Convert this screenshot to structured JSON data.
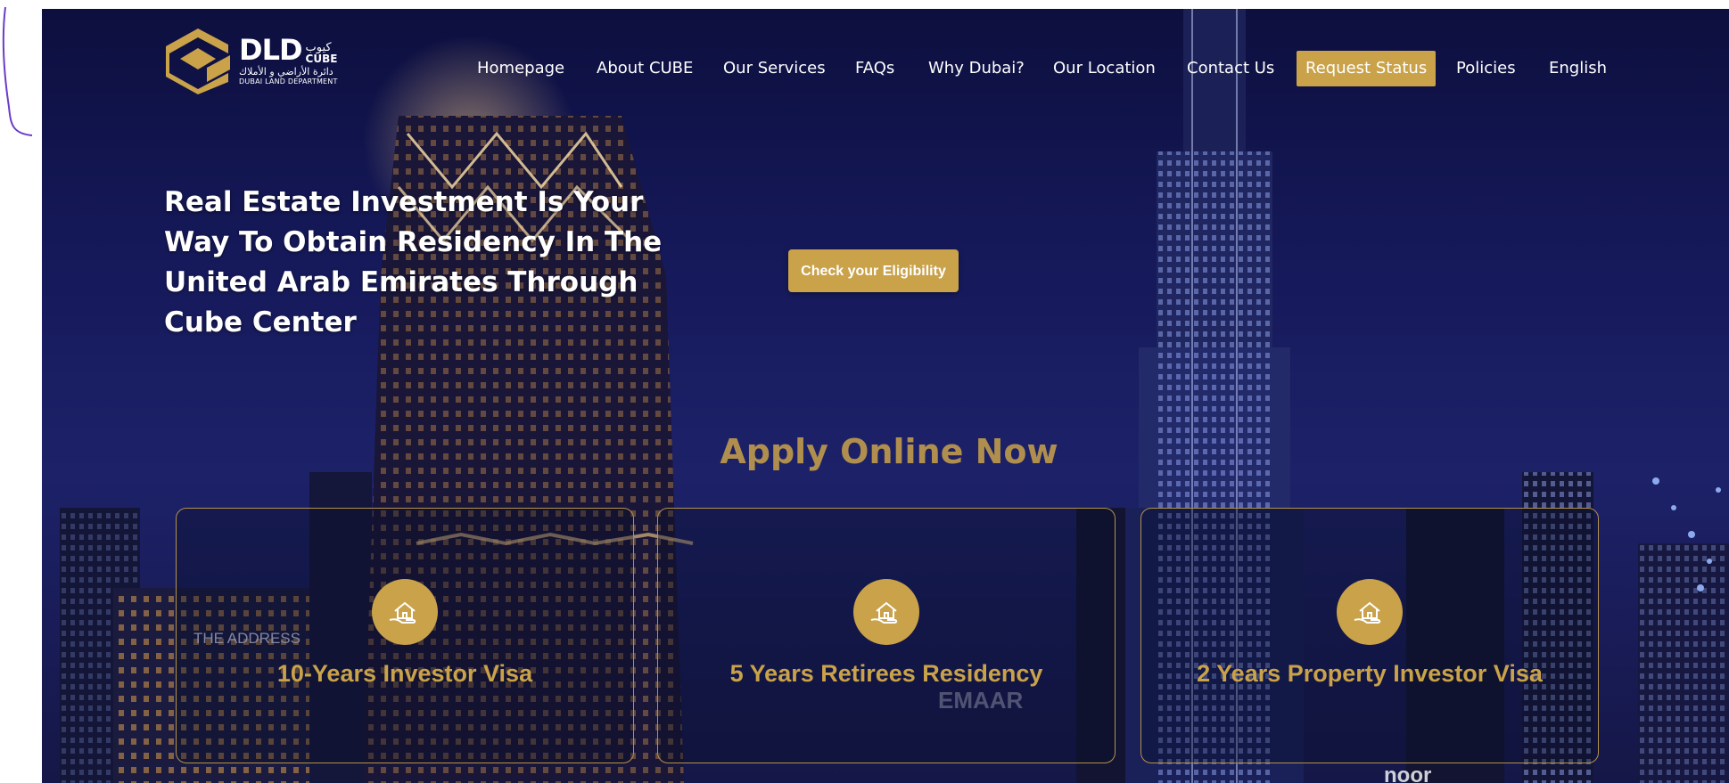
{
  "logo": {
    "text": "DLD",
    "ar_text": "كيوب",
    "cube_text": "CUBE",
    "sub_ar": "دائرة الأراضي و الأملاك",
    "sub_en": "DUBAI LAND DEPARTMENT"
  },
  "nav": {
    "items": [
      {
        "label": "Homepage"
      },
      {
        "label": "About CUBE"
      },
      {
        "label": "Our Services"
      },
      {
        "label": "FAQs"
      },
      {
        "label": "Why Dubai?"
      },
      {
        "label": "Our Location"
      },
      {
        "label": "Contact Us"
      },
      {
        "label": "Request Status",
        "active": true
      },
      {
        "label": "Policies"
      },
      {
        "label": "English"
      }
    ]
  },
  "hero": {
    "title": "Real Estate Investment Is Your Way To Obtain Residency In The United Arab Emirates Through Cube Center",
    "eligibility_button": "Check your Eligibility"
  },
  "apply": {
    "heading": "Apply Online Now",
    "cards": [
      {
        "title": "10-Years Investor Visa",
        "icon": "house-hand-icon"
      },
      {
        "title": "5 Years Retirees Residency",
        "icon": "house-hand-icon"
      },
      {
        "title": "2 Years Property Investor Visa",
        "icon": "house-hand-icon"
      }
    ]
  },
  "background": {
    "signs": [
      "THE ADDRESS",
      "EMAAR",
      "noor"
    ]
  },
  "colors": {
    "accent": "#c9a24a",
    "heading": "#b08f4e",
    "night_sky": "#161a5c"
  }
}
